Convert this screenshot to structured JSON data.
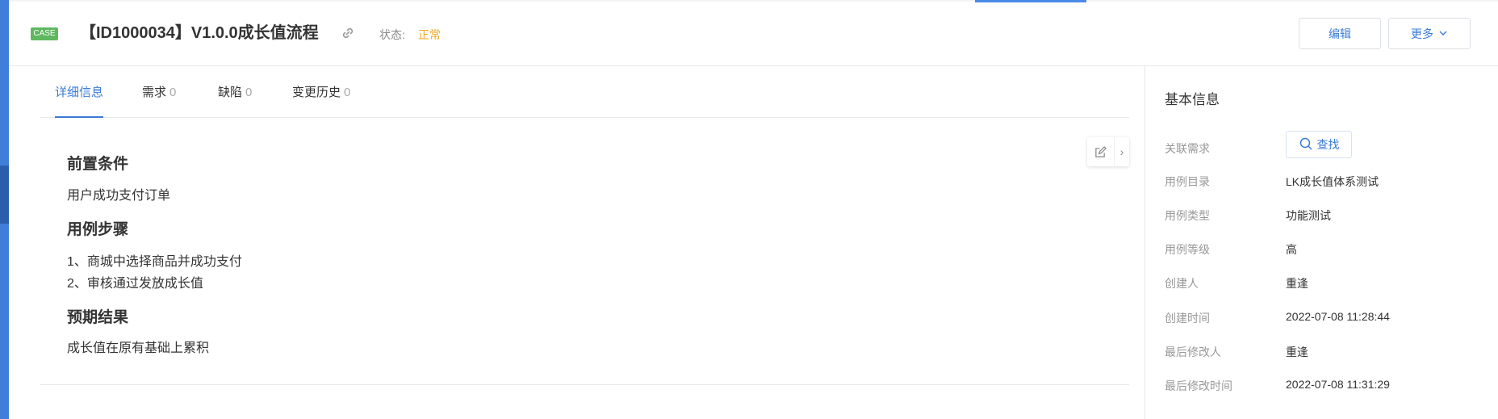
{
  "header": {
    "badge": "CASE",
    "title": "【ID1000034】V1.0.0成长值流程",
    "status_label": "状态:",
    "status_value": "正常",
    "edit_label": "编辑",
    "more_label": "更多"
  },
  "tabs": [
    {
      "label": "详细信息",
      "count": ""
    },
    {
      "label": "需求",
      "count": "0"
    },
    {
      "label": "缺陷",
      "count": "0"
    },
    {
      "label": "变更历史",
      "count": "0"
    }
  ],
  "content": {
    "precondition_title": "前置条件",
    "precondition_text": "用户成功支付订单",
    "steps_title": "用例步骤",
    "steps": [
      "1、商城中选择商品并成功支付",
      "2、审核通过发放成长值"
    ],
    "expected_title": "预期结果",
    "expected_text": "成长值在原有基础上累积"
  },
  "basic_info": {
    "title": "基本信息",
    "related_req_label": "关联需求",
    "search_label": "查找",
    "rows": [
      {
        "label": "用例目录",
        "value": "LK成长值体系测试"
      },
      {
        "label": "用例类型",
        "value": "功能测试"
      },
      {
        "label": "用例等级",
        "value": "高"
      },
      {
        "label": "创建人",
        "value": "重逢"
      },
      {
        "label": "创建时间",
        "value": "2022-07-08 11:28:44"
      },
      {
        "label": "最后修改人",
        "value": "重逢"
      },
      {
        "label": "最后修改时间",
        "value": "2022-07-08 11:31:29"
      }
    ]
  },
  "icons": [
    "link-icon",
    "chevron-down-icon",
    "edit-icon",
    "chevron-right-icon",
    "search-icon"
  ],
  "colors": {
    "accent": "#3a7bd5",
    "badge": "#5fb85f",
    "status": "#f5a623",
    "sidebar": "#3f7ed9"
  }
}
